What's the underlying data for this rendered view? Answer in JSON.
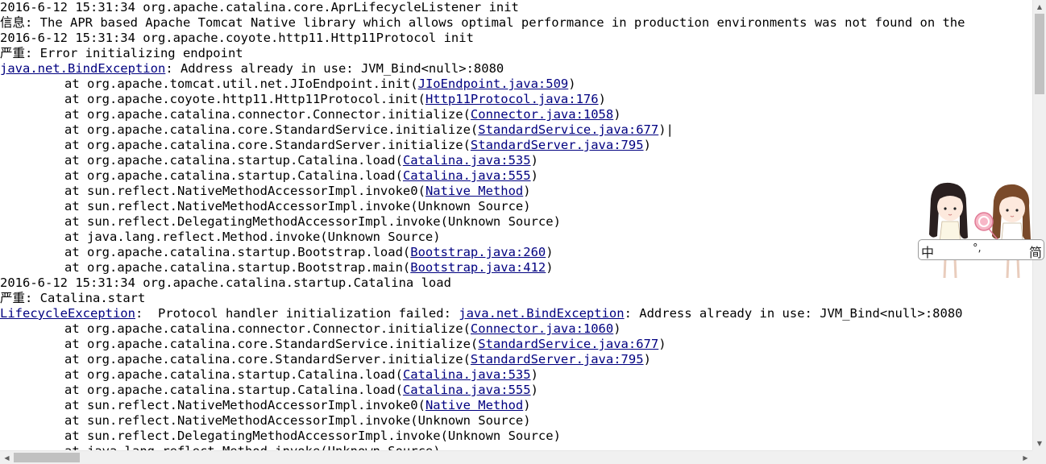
{
  "console": {
    "lines": [
      {
        "indent": false,
        "parts": [
          {
            "t": "2016-6-12 15:31:34 org.apache.catalina.core.AprLifecycleListener init"
          }
        ]
      },
      {
        "indent": false,
        "parts": [
          {
            "t": "信息: The APR based Apache Tomcat Native library which allows optimal performance in production environments was not found on the"
          }
        ]
      },
      {
        "indent": false,
        "parts": [
          {
            "t": "2016-6-12 15:31:34 org.apache.coyote.http11.Http11Protocol init"
          }
        ]
      },
      {
        "indent": false,
        "parts": [
          {
            "t": "严重: Error initializing endpoint"
          }
        ]
      },
      {
        "indent": false,
        "parts": [
          {
            "t": "java.net.BindException",
            "link": true
          },
          {
            "t": ": Address already in use: JVM_Bind<null>:8080"
          }
        ]
      },
      {
        "indent": true,
        "parts": [
          {
            "t": "at org.apache.tomcat.util.net.JIoEndpoint.init("
          },
          {
            "t": "JIoEndpoint.java:509",
            "link": true
          },
          {
            "t": ")"
          }
        ]
      },
      {
        "indent": true,
        "parts": [
          {
            "t": "at org.apache.coyote.http11.Http11Protocol.init("
          },
          {
            "t": "Http11Protocol.java:176",
            "link": true
          },
          {
            "t": ")"
          }
        ]
      },
      {
        "indent": true,
        "parts": [
          {
            "t": "at org.apache.catalina.connector.Connector.initialize("
          },
          {
            "t": "Connector.java:1058",
            "link": true
          },
          {
            "t": ")"
          }
        ]
      },
      {
        "indent": true,
        "parts": [
          {
            "t": "at org.apache.catalina.core.StandardService.initialize("
          },
          {
            "t": "StandardService.java:677",
            "link": true
          },
          {
            "t": ")|"
          }
        ]
      },
      {
        "indent": true,
        "parts": [
          {
            "t": "at org.apache.catalina.core.StandardServer.initialize("
          },
          {
            "t": "StandardServer.java:795",
            "link": true
          },
          {
            "t": ")"
          }
        ]
      },
      {
        "indent": true,
        "parts": [
          {
            "t": "at org.apache.catalina.startup.Catalina.load("
          },
          {
            "t": "Catalina.java:535",
            "link": true
          },
          {
            "t": ")"
          }
        ]
      },
      {
        "indent": true,
        "parts": [
          {
            "t": "at org.apache.catalina.startup.Catalina.load("
          },
          {
            "t": "Catalina.java:555",
            "link": true
          },
          {
            "t": ")"
          }
        ]
      },
      {
        "indent": true,
        "parts": [
          {
            "t": "at sun.reflect.NativeMethodAccessorImpl.invoke0("
          },
          {
            "t": "Native Method",
            "link": true
          },
          {
            "t": ")"
          }
        ]
      },
      {
        "indent": true,
        "parts": [
          {
            "t": "at sun.reflect.NativeMethodAccessorImpl.invoke(Unknown Source)"
          }
        ]
      },
      {
        "indent": true,
        "parts": [
          {
            "t": "at sun.reflect.DelegatingMethodAccessorImpl.invoke(Unknown Source)"
          }
        ]
      },
      {
        "indent": true,
        "parts": [
          {
            "t": "at java.lang.reflect.Method.invoke(Unknown Source)"
          }
        ]
      },
      {
        "indent": true,
        "parts": [
          {
            "t": "at org.apache.catalina.startup.Bootstrap.load("
          },
          {
            "t": "Bootstrap.java:260",
            "link": true
          },
          {
            "t": ")"
          }
        ]
      },
      {
        "indent": true,
        "parts": [
          {
            "t": "at org.apache.catalina.startup.Bootstrap.main("
          },
          {
            "t": "Bootstrap.java:412",
            "link": true
          },
          {
            "t": ")"
          }
        ]
      },
      {
        "indent": false,
        "parts": [
          {
            "t": "2016-6-12 15:31:34 org.apache.catalina.startup.Catalina load"
          }
        ]
      },
      {
        "indent": false,
        "parts": [
          {
            "t": "严重: Catalina.start"
          }
        ]
      },
      {
        "indent": false,
        "parts": [
          {
            "t": "LifecycleException",
            "link": true
          },
          {
            "t": ":  Protocol handler initialization failed: "
          },
          {
            "t": "java.net.BindException",
            "link": true
          },
          {
            "t": ": Address already in use: JVM_Bind<null>:8080"
          }
        ]
      },
      {
        "indent": true,
        "parts": [
          {
            "t": "at org.apache.catalina.connector.Connector.initialize("
          },
          {
            "t": "Connector.java:1060",
            "link": true
          },
          {
            "t": ")"
          }
        ]
      },
      {
        "indent": true,
        "parts": [
          {
            "t": "at org.apache.catalina.core.StandardService.initialize("
          },
          {
            "t": "StandardService.java:677",
            "link": true
          },
          {
            "t": ")"
          }
        ]
      },
      {
        "indent": true,
        "parts": [
          {
            "t": "at org.apache.catalina.core.StandardServer.initialize("
          },
          {
            "t": "StandardServer.java:795",
            "link": true
          },
          {
            "t": ")"
          }
        ]
      },
      {
        "indent": true,
        "parts": [
          {
            "t": "at org.apache.catalina.startup.Catalina.load("
          },
          {
            "t": "Catalina.java:535",
            "link": true
          },
          {
            "t": ")"
          }
        ]
      },
      {
        "indent": true,
        "parts": [
          {
            "t": "at org.apache.catalina.startup.Catalina.load("
          },
          {
            "t": "Catalina.java:555",
            "link": true
          },
          {
            "t": ")"
          }
        ]
      },
      {
        "indent": true,
        "parts": [
          {
            "t": "at sun.reflect.NativeMethodAccessorImpl.invoke0("
          },
          {
            "t": "Native Method",
            "link": true
          },
          {
            "t": ")"
          }
        ]
      },
      {
        "indent": true,
        "parts": [
          {
            "t": "at sun.reflect.NativeMethodAccessorImpl.invoke(Unknown Source)"
          }
        ]
      },
      {
        "indent": true,
        "parts": [
          {
            "t": "at sun.reflect.DelegatingMethodAccessorImpl.invoke(Unknown Source)"
          }
        ]
      },
      {
        "indent": true,
        "parts": [
          {
            "t": "at java.lang.reflect.Method.invoke(Unknown Source)"
          }
        ]
      }
    ]
  },
  "ime_toolbar": {
    "mode_label": "中",
    "punct_label": "°,",
    "script_label": "简",
    "icon": "cartoon-girls-skin"
  },
  "colors": {
    "link": "#000080",
    "text": "#000000",
    "background": "#ffffff",
    "scrollbar_track": "#f0f0f0",
    "scrollbar_thumb": "#c1c1c1"
  }
}
